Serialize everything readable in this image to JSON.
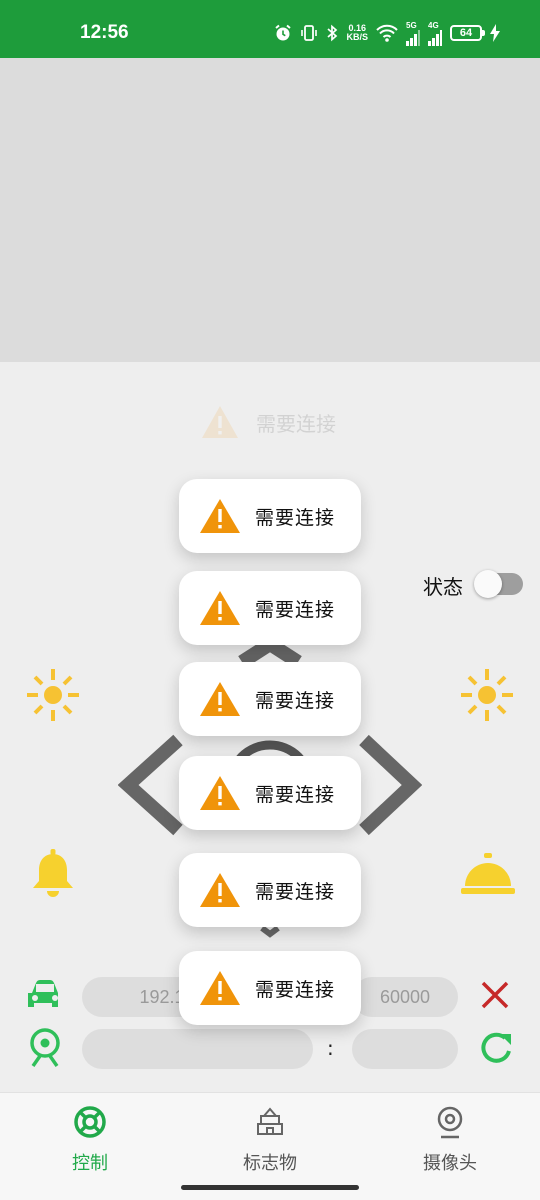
{
  "status_bar": {
    "time": "12:56",
    "net_speed_value": "0.16",
    "net_speed_unit": "KB/S",
    "signal1": "5G",
    "signal2": "4G",
    "battery": "64"
  },
  "toast_message": "需要连接",
  "toasts": [
    "需要连接",
    "需要连接",
    "需要连接",
    "需要连接",
    "需要连接",
    "需要连接"
  ],
  "status": {
    "label": "状态",
    "toggle_on": false
  },
  "connection": {
    "car_ip": "192.1",
    "car_port": "60000",
    "camera_ip": "",
    "camera_port": ""
  },
  "nav": {
    "tabs": [
      {
        "label": "控制",
        "active": true
      },
      {
        "label": "标志物",
        "active": false
      },
      {
        "label": "摄像头",
        "active": false
      }
    ]
  },
  "colors": {
    "status_bar": "#1e9c3b",
    "accent_green": "#21a94a",
    "warning": "#f0940a",
    "sun_yellow": "#f6c233",
    "close_red": "#c62828"
  },
  "icons": [
    "alarm-icon",
    "vibrate-icon",
    "bluetooth-icon",
    "wifi-icon",
    "sun-icon",
    "bell-icon",
    "service-bell-icon",
    "car-icon",
    "webcam-icon",
    "close-icon",
    "refresh-icon",
    "warning-icon"
  ]
}
